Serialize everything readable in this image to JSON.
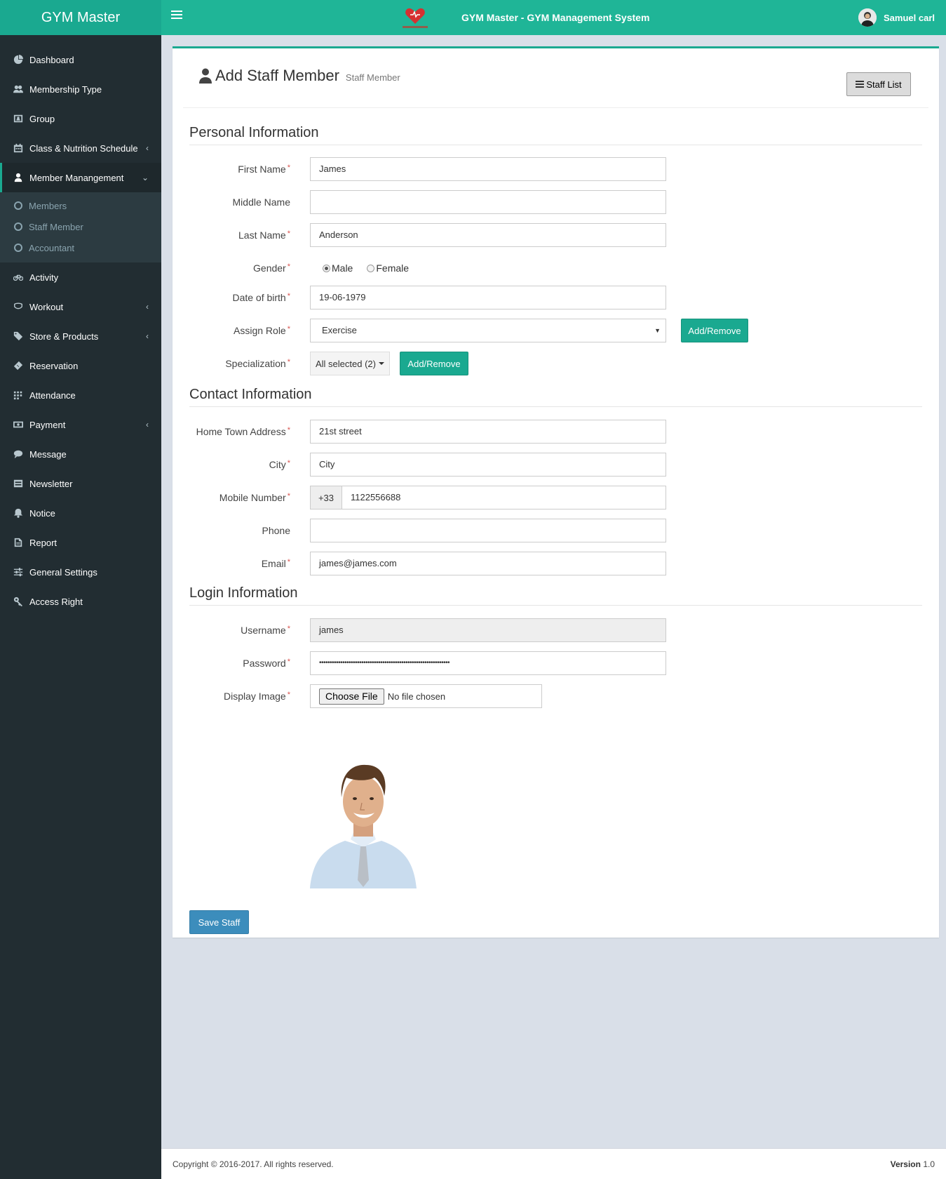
{
  "app": {
    "brand": "GYM Master",
    "system_title": "GYM Master - GYM Management System",
    "user_name": "Samuel carl"
  },
  "sidebar": {
    "items": [
      {
        "label": "Dashboard",
        "icon": "dashboard-icon"
      },
      {
        "label": "Membership Type",
        "icon": "users-icon"
      },
      {
        "label": "Group",
        "icon": "group-icon"
      },
      {
        "label": "Class & Nutrition Schedule",
        "icon": "calendar-icon"
      },
      {
        "label": "Member Manangement",
        "icon": "user-icon"
      },
      {
        "label": "Activity",
        "icon": "bicycle-icon"
      },
      {
        "label": "Workout",
        "icon": "workout-icon"
      },
      {
        "label": "Store & Products",
        "icon": "tags-icon"
      },
      {
        "label": "Reservation",
        "icon": "ticket-icon"
      },
      {
        "label": "Attendance",
        "icon": "attendance-icon"
      },
      {
        "label": "Payment",
        "icon": "money-icon"
      },
      {
        "label": "Message",
        "icon": "comment-icon"
      },
      {
        "label": "Newsletter",
        "icon": "newsletter-icon"
      },
      {
        "label": "Notice",
        "icon": "bell-icon"
      },
      {
        "label": "Report",
        "icon": "report-icon"
      },
      {
        "label": "General Settings",
        "icon": "sliders-icon"
      },
      {
        "label": "Access Right",
        "icon": "key-icon"
      }
    ],
    "submenu": [
      {
        "label": "Members"
      },
      {
        "label": "Staff Member"
      },
      {
        "label": "Accountant"
      }
    ]
  },
  "page": {
    "title": "Add Staff Member",
    "subtitle": "Staff Member",
    "staff_list_button": "Staff List"
  },
  "sections": {
    "personal": "Personal Information",
    "contact": "Contact Information",
    "login": "Login Information"
  },
  "form": {
    "first_name": {
      "label": "First Name",
      "value": "James"
    },
    "middle_name": {
      "label": "Middle Name",
      "value": ""
    },
    "last_name": {
      "label": "Last Name",
      "value": "Anderson"
    },
    "gender": {
      "label": "Gender",
      "options": [
        "Male",
        "Female"
      ],
      "selected": "Male"
    },
    "dob": {
      "label": "Date of birth",
      "value": "19-06-1979"
    },
    "role": {
      "label": "Assign Role",
      "value": "Exercise",
      "button": "Add/Remove"
    },
    "specialization": {
      "label": "Specialization",
      "value": "All selected (2)",
      "button": "Add/Remove"
    },
    "address": {
      "label": "Home Town Address",
      "value": "21st street"
    },
    "city": {
      "label": "City",
      "value": "City"
    },
    "mobile": {
      "label": "Mobile Number",
      "prefix": "+33",
      "value": "1122556688"
    },
    "phone": {
      "label": "Phone",
      "value": ""
    },
    "email": {
      "label": "Email",
      "value": "james@james.com"
    },
    "username": {
      "label": "Username",
      "value": "james"
    },
    "password": {
      "label": "Password",
      "value": "••••••••••••••••••••••••••••••••••••••••••••••••••••••••••••••"
    },
    "display_image": {
      "label": "Display Image",
      "button": "Choose File",
      "status": "No file chosen"
    },
    "save_button": "Save Staff"
  },
  "footer": {
    "copyright": "Copyright © 2016-2017. All rights reserved.",
    "version_label": "Version",
    "version": "1.0"
  },
  "colors": {
    "accent": "#1aa990",
    "topbar": "#1fb597",
    "sidebar": "#222d32",
    "primary_button": "#3c8dbc"
  }
}
